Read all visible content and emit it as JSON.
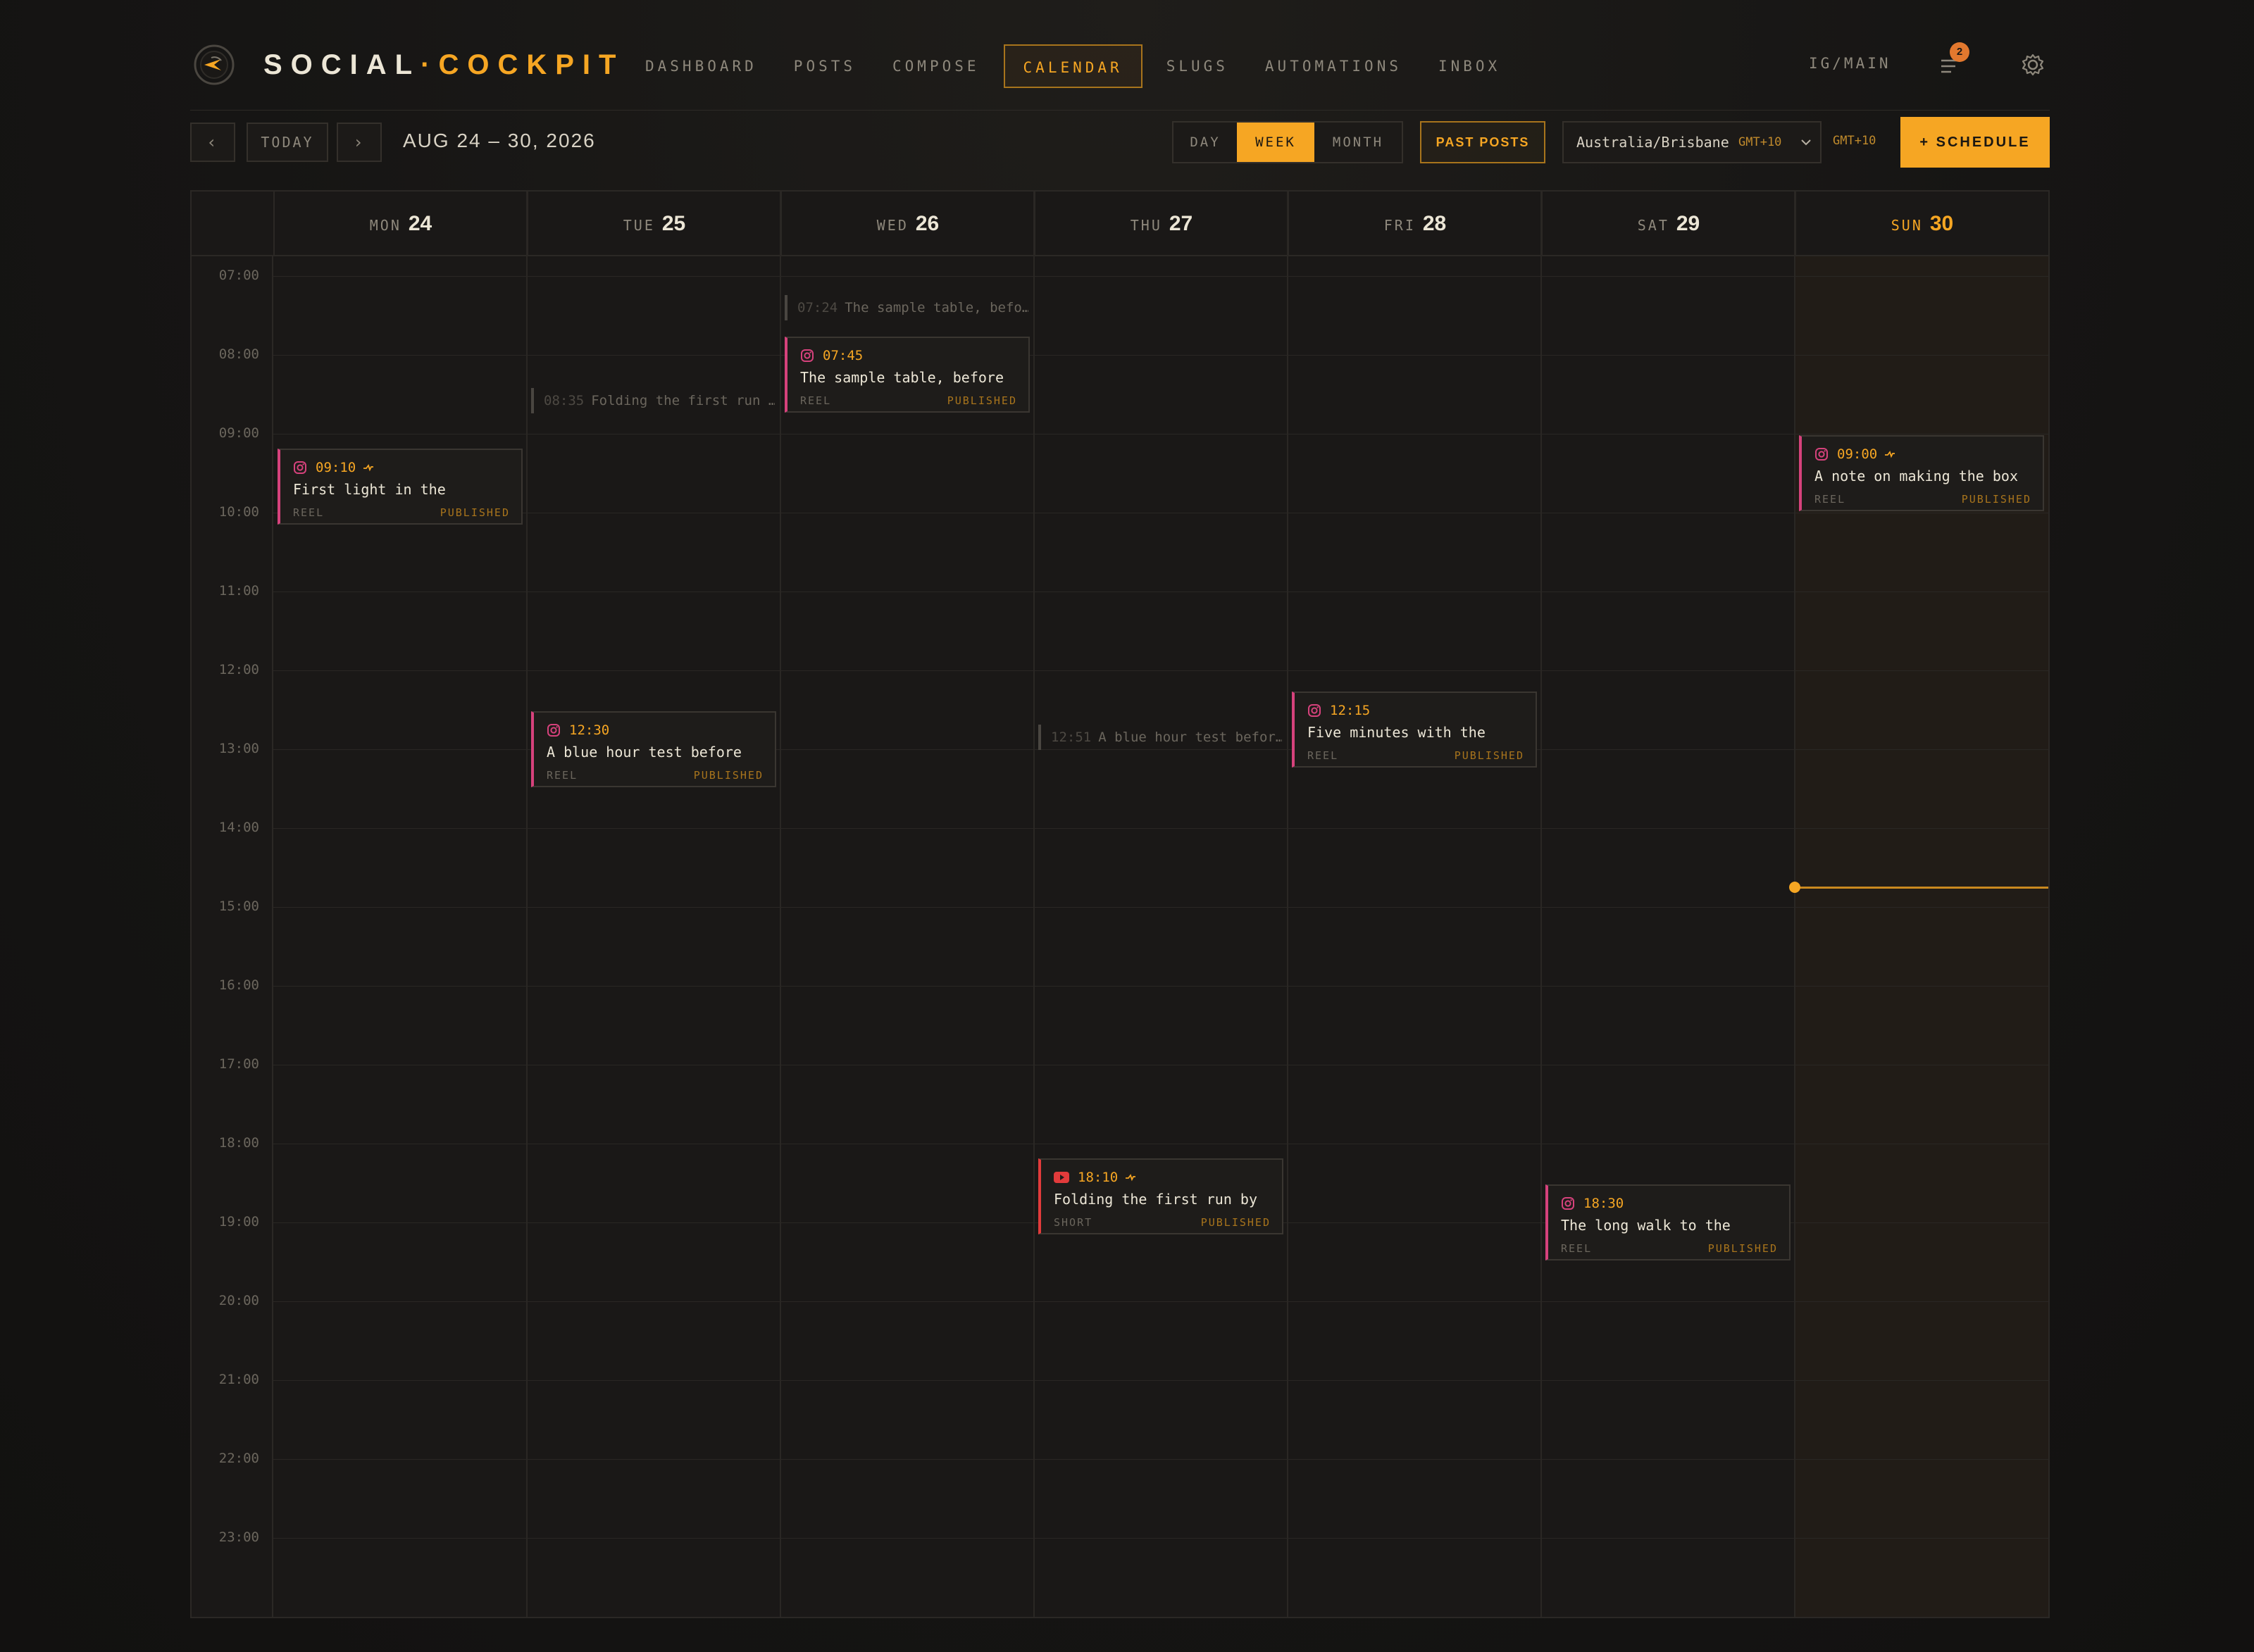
{
  "brand": {
    "left": "SOCIAL",
    "sep": "·",
    "right": "COCKPIT"
  },
  "nav": [
    "DASHBOARD",
    "POSTS",
    "COMPOSE",
    "CALENDAR",
    "SLUGS",
    "AUTOMATIONS",
    "INBOX"
  ],
  "nav_active": "CALENDAR",
  "account": "IG/MAIN",
  "notifications": "2",
  "toolbar": {
    "prev": "‹",
    "today": "TODAY",
    "next": "›",
    "range": "AUG 24 – 30, 2026",
    "views": [
      "DAY",
      "WEEK",
      "MONTH"
    ],
    "active_view": "WEEK",
    "past_posts": "PAST POSTS",
    "timezone": "Australia/Brisbane",
    "timezone_offset": "GMT+10",
    "timezone_side": "GMT+10",
    "schedule": "+ SCHEDULE"
  },
  "days": [
    {
      "name": "MON",
      "date": "24"
    },
    {
      "name": "TUE",
      "date": "25"
    },
    {
      "name": "WED",
      "date": "26"
    },
    {
      "name": "THU",
      "date": "27"
    },
    {
      "name": "FRI",
      "date": "28"
    },
    {
      "name": "SAT",
      "date": "29"
    },
    {
      "name": "SUN",
      "date": "30",
      "today": true
    }
  ],
  "hours": [
    "07:00",
    "08:00",
    "09:00",
    "10:00",
    "11:00",
    "12:00",
    "13:00",
    "14:00",
    "15:00",
    "16:00",
    "17:00",
    "18:00",
    "19:00",
    "20:00",
    "21:00",
    "22:00",
    "23:00"
  ],
  "events": [
    {
      "day": 0,
      "start": "09:10",
      "time": "09:10",
      "auto": true,
      "platform": "instagram",
      "title": "First light in the",
      "type": "REEL",
      "status": "PUBLISHED"
    },
    {
      "day": 1,
      "start": "12:30",
      "time": "12:30",
      "auto": false,
      "platform": "instagram",
      "title": "A blue hour test before",
      "type": "REEL",
      "status": "PUBLISHED"
    },
    {
      "day": 2,
      "start": "07:45",
      "time": "07:45",
      "auto": false,
      "platform": "instagram",
      "title": "The sample table, before",
      "type": "REEL",
      "status": "PUBLISHED"
    },
    {
      "day": 3,
      "start": "18:10",
      "time": "18:10",
      "auto": true,
      "platform": "youtube",
      "title": "Folding the first run by",
      "type": "SHORT",
      "status": "PUBLISHED"
    },
    {
      "day": 4,
      "start": "12:15",
      "time": "12:15",
      "auto": false,
      "platform": "instagram",
      "title": "Five minutes with the",
      "type": "REEL",
      "status": "PUBLISHED"
    },
    {
      "day": 5,
      "start": "18:30",
      "time": "18:30",
      "auto": false,
      "platform": "instagram",
      "title": "The long walk to the",
      "type": "REEL",
      "status": "PUBLISHED"
    },
    {
      "day": 6,
      "start": "09:00",
      "time": "09:00",
      "auto": true,
      "platform": "instagram",
      "title": "A note on making the box",
      "type": "REEL",
      "status": "PUBLISHED"
    }
  ],
  "ghosts": [
    {
      "day": 1,
      "start": "08:35",
      "time": "08:35",
      "title": "Folding the first run …"
    },
    {
      "day": 2,
      "start": "07:24",
      "time": "07:24",
      "title": "The sample table, befo…"
    },
    {
      "day": 3,
      "start": "12:51",
      "time": "12:51",
      "title": "A blue hour test befor…"
    }
  ],
  "now_time": "14:45",
  "colors": {
    "accent": "#f6a623",
    "instagram": "#d6427c",
    "youtube": "#e23b3b",
    "background": "#161514"
  }
}
